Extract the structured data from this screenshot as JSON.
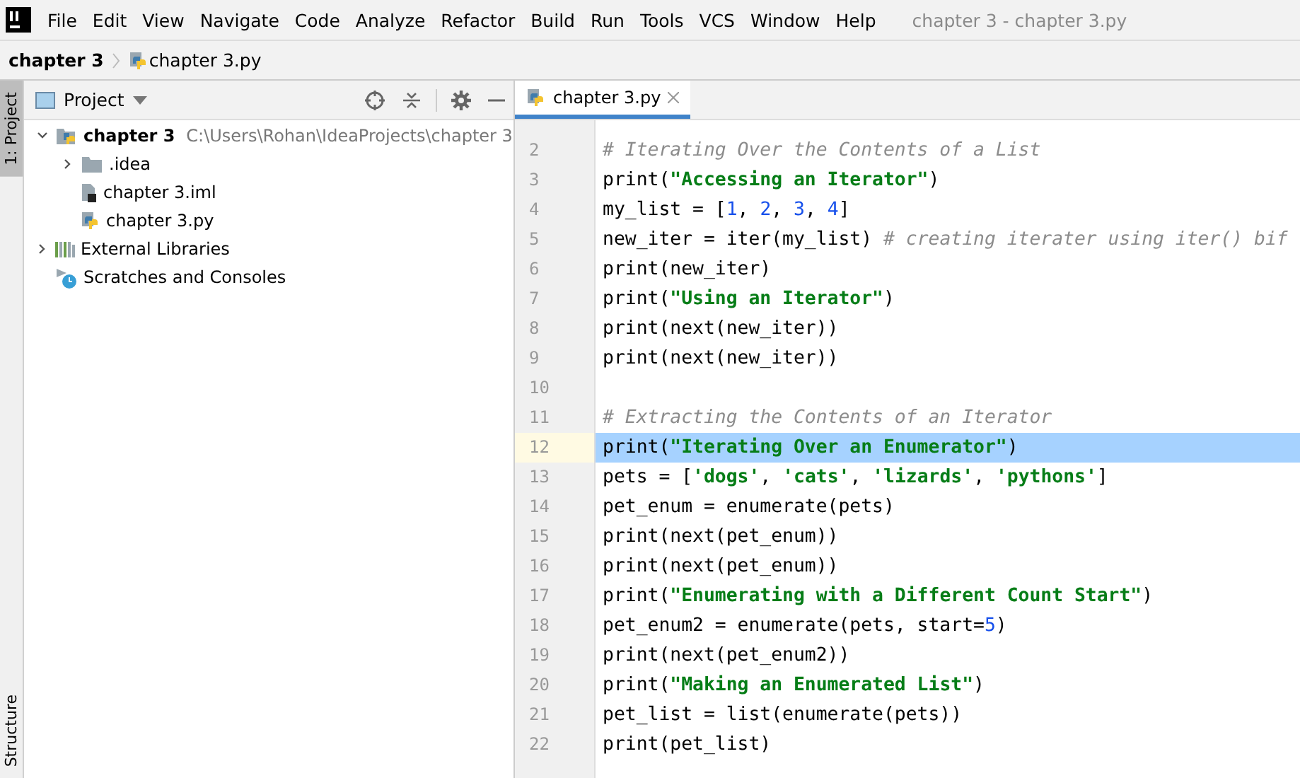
{
  "menu": [
    "File",
    "Edit",
    "View",
    "Navigate",
    "Code",
    "Analyze",
    "Refactor",
    "Build",
    "Run",
    "Tools",
    "VCS",
    "Window",
    "Help"
  ],
  "window_title": "chapter 3 - chapter 3.py",
  "breadcrumb": [
    {
      "label": "chapter 3",
      "kind": "project"
    },
    {
      "label": "chapter 3.py",
      "kind": "python"
    }
  ],
  "left_stripe": [
    {
      "label": "1: Project",
      "selected": true
    },
    {
      "label": "Structure",
      "selected": false
    }
  ],
  "project_panel": {
    "title": "Project",
    "tree": [
      {
        "label": "chapter 3",
        "detail": "C:\\Users\\Rohan\\IdeaProjects\\chapter 3",
        "kind": "project",
        "expanded": true,
        "children": [
          {
            "label": ".idea",
            "kind": "folder",
            "expanded": false
          },
          {
            "label": "chapter 3.iml",
            "kind": "iml"
          },
          {
            "label": "chapter 3.py",
            "kind": "python"
          }
        ]
      },
      {
        "label": "External Libraries",
        "kind": "libraries",
        "expanded": false
      },
      {
        "label": "Scratches and Consoles",
        "kind": "scratches"
      }
    ]
  },
  "editor": {
    "tabs": [
      {
        "label": "chapter 3.py",
        "selected": true
      }
    ],
    "lines": [
      {
        "number": "2",
        "segments": [
          {
            "kind": "comment",
            "text": "# Iterating Over the Contents of a List"
          }
        ]
      },
      {
        "number": "3",
        "segments": [
          {
            "kind": "plain",
            "text": "print("
          },
          {
            "kind": "string",
            "text": "\"Accessing an Iterator\""
          },
          {
            "kind": "plain",
            "text": ")"
          }
        ]
      },
      {
        "number": "4",
        "segments": [
          {
            "kind": "plain",
            "text": "my_list = ["
          },
          {
            "kind": "number",
            "text": "1"
          },
          {
            "kind": "plain",
            "text": ", "
          },
          {
            "kind": "number",
            "text": "2"
          },
          {
            "kind": "plain",
            "text": ", "
          },
          {
            "kind": "number",
            "text": "3"
          },
          {
            "kind": "plain",
            "text": ", "
          },
          {
            "kind": "number",
            "text": "4"
          },
          {
            "kind": "plain",
            "text": "]"
          }
        ]
      },
      {
        "number": "5",
        "segments": [
          {
            "kind": "plain",
            "text": "new_iter = iter(my_list) "
          },
          {
            "kind": "comment",
            "text": "# creating iterater using iter() bif"
          }
        ]
      },
      {
        "number": "6",
        "segments": [
          {
            "kind": "plain",
            "text": "print(new_iter)"
          }
        ]
      },
      {
        "number": "7",
        "segments": [
          {
            "kind": "plain",
            "text": "print("
          },
          {
            "kind": "string",
            "text": "\"Using an Iterator\""
          },
          {
            "kind": "plain",
            "text": ")"
          }
        ]
      },
      {
        "number": "8",
        "segments": [
          {
            "kind": "plain",
            "text": "print(next(new_iter))"
          }
        ]
      },
      {
        "number": "9",
        "segments": [
          {
            "kind": "plain",
            "text": "print(next(new_iter))"
          }
        ]
      },
      {
        "number": "10"
      },
      {
        "number": "11",
        "segments": [
          {
            "kind": "comment",
            "text": "# Extracting the Contents of an Iterator"
          }
        ]
      },
      {
        "number": "12",
        "selected": true,
        "segments": [
          {
            "kind": "plain",
            "text": "print("
          },
          {
            "kind": "string",
            "text": "\"Iterating Over an Enumerator\""
          },
          {
            "kind": "plain",
            "text": ")"
          }
        ]
      },
      {
        "number": "13",
        "segments": [
          {
            "kind": "plain",
            "text": "pets = ["
          },
          {
            "kind": "string",
            "text": "'dogs'"
          },
          {
            "kind": "plain",
            "text": ", "
          },
          {
            "kind": "string",
            "text": "'cats'"
          },
          {
            "kind": "plain",
            "text": ", "
          },
          {
            "kind": "string",
            "text": "'lizards'"
          },
          {
            "kind": "plain",
            "text": ", "
          },
          {
            "kind": "string",
            "text": "'pythons'"
          },
          {
            "kind": "plain",
            "text": "]"
          }
        ]
      },
      {
        "number": "14",
        "segments": [
          {
            "kind": "plain",
            "text": "pet_enum = enumerate(pets)"
          }
        ]
      },
      {
        "number": "15",
        "segments": [
          {
            "kind": "plain",
            "text": "print(next(pet_enum))"
          }
        ]
      },
      {
        "number": "16",
        "segments": [
          {
            "kind": "plain",
            "text": "print(next(pet_enum))"
          }
        ]
      },
      {
        "number": "17",
        "segments": [
          {
            "kind": "plain",
            "text": "print("
          },
          {
            "kind": "string",
            "text": "\"Enumerating with a Different Count Start\""
          },
          {
            "kind": "plain",
            "text": ")"
          }
        ]
      },
      {
        "number": "18",
        "segments": [
          {
            "kind": "plain",
            "text": "pet_enum2 = enumerate(pets, start="
          },
          {
            "kind": "number",
            "text": "5"
          },
          {
            "kind": "plain",
            "text": ")"
          }
        ]
      },
      {
        "number": "19",
        "segments": [
          {
            "kind": "plain",
            "text": "print(next(pet_enum2))"
          }
        ]
      },
      {
        "number": "20",
        "segments": [
          {
            "kind": "plain",
            "text": "print("
          },
          {
            "kind": "string",
            "text": "\"Making an Enumerated List\""
          },
          {
            "kind": "plain",
            "text": ")"
          }
        ]
      },
      {
        "number": "21",
        "segments": [
          {
            "kind": "plain",
            "text": "pet_list = list(enumerate(pets))"
          }
        ]
      },
      {
        "number": "22",
        "segments": [
          {
            "kind": "plain",
            "text": "print(pet_list)"
          }
        ]
      }
    ]
  }
}
